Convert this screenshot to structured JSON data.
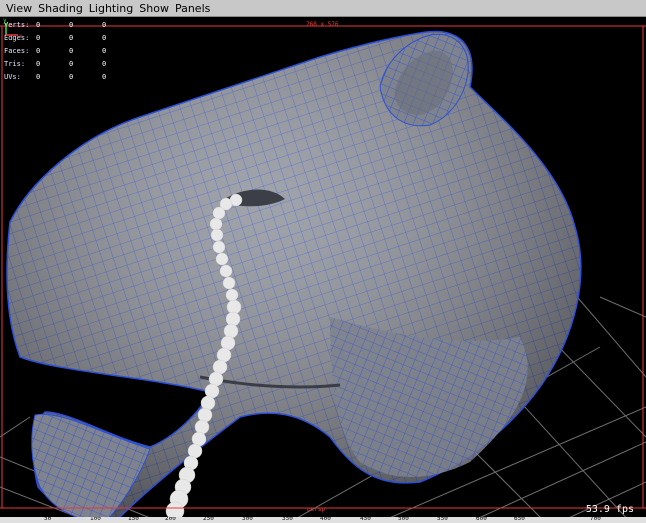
{
  "menu": [
    "View",
    "Shading",
    "Lighting",
    "Show",
    "Panels"
  ],
  "hud": {
    "rows": [
      {
        "label": "Verts:",
        "values": [
          "0",
          "0",
          "0"
        ]
      },
      {
        "label": "Edges:",
        "values": [
          "0",
          "0",
          "0"
        ]
      },
      {
        "label": "Faces:",
        "values": [
          "0",
          "0",
          "0"
        ]
      },
      {
        "label": "Tris:",
        "values": [
          "0",
          "0",
          "0"
        ]
      },
      {
        "label": "UVs:",
        "values": [
          "0",
          "0",
          "0"
        ]
      }
    ]
  },
  "resolution_gate": "768 x 576",
  "camera": "persp",
  "fps": "53.9 fps",
  "ruler_ticks": [
    "50",
    "100",
    "150",
    "200",
    "250",
    "300",
    "350",
    "400",
    "450",
    "500",
    "550",
    "600",
    "650",
    "700"
  ],
  "axis": {
    "y_label": "y",
    "x_label": "x"
  },
  "colors": {
    "gate": "#e83a3a",
    "wire": "#2b4fd8",
    "mesh": "#8c8f98",
    "grid": "#6f6f6f"
  }
}
